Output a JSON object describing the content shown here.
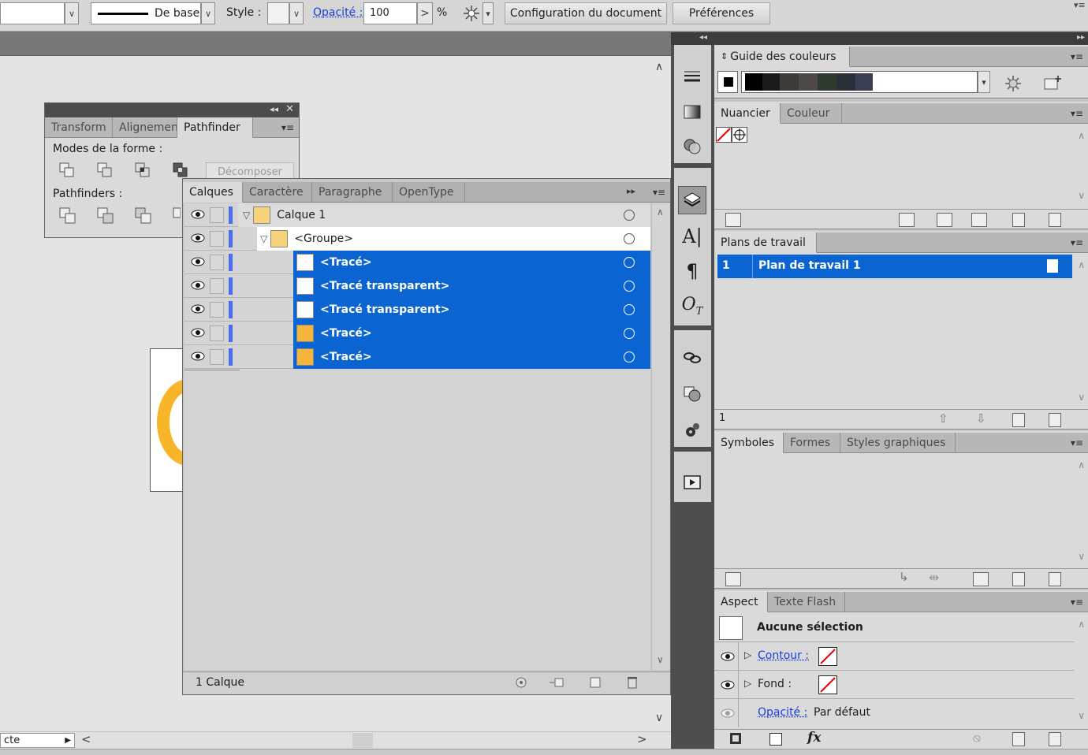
{
  "controlbar": {
    "stroke_weight": "De base",
    "style_label": "Style :",
    "opacity_label": "Opacité :",
    "opacity_value": "100",
    "percent": "%",
    "arrow_right": ">",
    "doc_setup_button": "Configuration du document",
    "preferences_button": "Préférences"
  },
  "pathfinder_panel": {
    "tabs": [
      "Transform",
      "Alignemen",
      "Pathfinder"
    ],
    "active_tab": "Pathfinder",
    "shape_modes_label": "Modes de la forme :",
    "expand_button": "Décomposer",
    "pathfinders_label": "Pathfinders :"
  },
  "layers_panel": {
    "tabs": [
      "Calques",
      "Caractère",
      "Paragraphe",
      "OpenType"
    ],
    "active_tab": "Calques",
    "rows": [
      {
        "name": "Calque 1",
        "level": 0,
        "expanded": true,
        "selected": false,
        "thumb": "layer"
      },
      {
        "name": "<Groupe>",
        "level": 1,
        "expanded": true,
        "selected": false,
        "thumb": "layer"
      },
      {
        "name": "<Tracé>",
        "level": 2,
        "selected": true,
        "thumb": "white"
      },
      {
        "name": "<Tracé transparent>",
        "level": 2,
        "selected": true,
        "thumb": "white"
      },
      {
        "name": "<Tracé transparent>",
        "level": 2,
        "selected": true,
        "thumb": "white"
      },
      {
        "name": "<Tracé>",
        "level": 2,
        "selected": true,
        "thumb": "orange"
      },
      {
        "name": "<Tracé>",
        "level": 2,
        "selected": true,
        "thumb": "orange"
      }
    ],
    "footer_count": "1 Calque"
  },
  "color_guide": {
    "title": "Guide des couleurs",
    "swatches": [
      "#000000",
      "#1b1b1b",
      "#3e3a3a",
      "#4d4747",
      "#2d3a2d",
      "#2a2f3a",
      "#3a3f55"
    ]
  },
  "swatches_panel": {
    "tabs": [
      "Nuancier",
      "Couleur"
    ],
    "active_tab": "Nuancier"
  },
  "artboards_panel": {
    "title": "Plans de travail",
    "rows": [
      {
        "number": "1",
        "name": "Plan de travail 1"
      }
    ],
    "footer_count": "1"
  },
  "symbols_panel": {
    "tabs": [
      "Symboles",
      "Formes",
      "Styles graphiques"
    ],
    "active_tab": "Symboles"
  },
  "appearance_panel": {
    "tabs": [
      "Aspect",
      "Texte Flash"
    ],
    "active_tab": "Aspect",
    "selection": "Aucune sélection",
    "stroke_label": "Contour :",
    "fill_label": "Fond :",
    "opacity_label": "Opacité :",
    "opacity_value": "Par défaut",
    "fx_label": "fx"
  },
  "status": {
    "left_text": "cte"
  },
  "colors": {
    "selection": "#0a64d2",
    "accent_orange": "#f5b53a",
    "link": "#1a3fd6"
  }
}
